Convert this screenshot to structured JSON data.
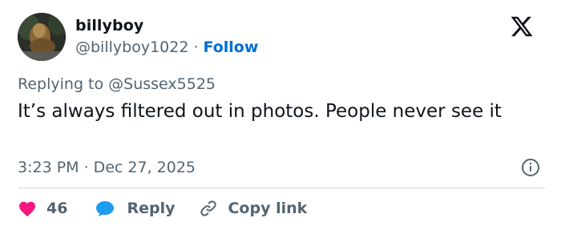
{
  "author": {
    "name": "billyboy",
    "handle": "@billyboy1022",
    "separator": "·",
    "follow_label": "Follow"
  },
  "reply_to": {
    "text": "Replying to @Sussex5525"
  },
  "tweet": {
    "text": "It’s always filtered out in photos. People never see it",
    "time": "3:23 PM",
    "separator": "·",
    "date": "Dec 27, 2025"
  },
  "actions": {
    "like_count": "46",
    "reply_label": "Reply",
    "copy_label": "Copy link"
  },
  "icons": {
    "brand": "x-logo-icon",
    "info": "info-icon",
    "like": "heart-icon",
    "reply": "speech-bubble-icon",
    "copy": "link-icon"
  },
  "colors": {
    "like": "#f91880",
    "reply": "#1d9bf0",
    "follow": "#006fd6",
    "secondary_text": "#536471",
    "primary_text": "#0f1419",
    "divider": "#cfd9de"
  }
}
